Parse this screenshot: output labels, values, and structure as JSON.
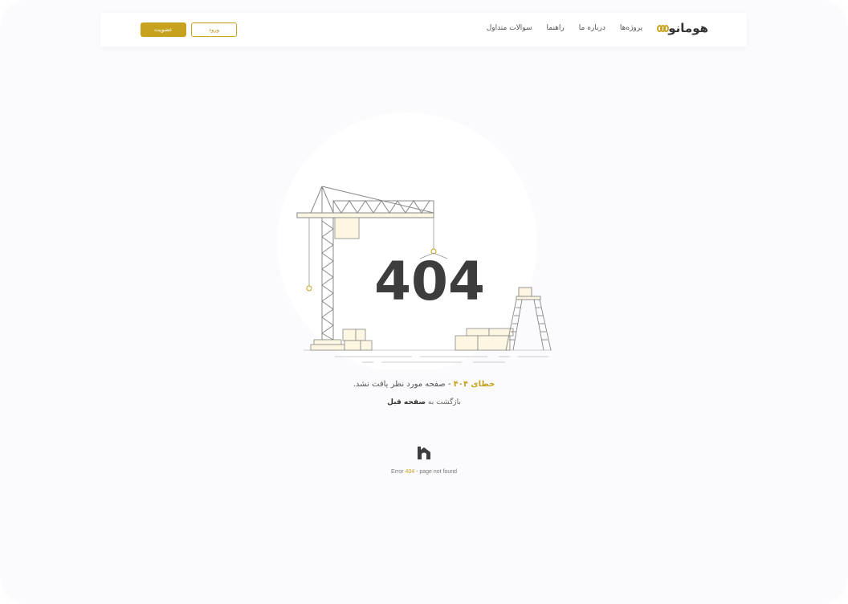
{
  "header": {
    "logo_text": "هومانو",
    "menu": [
      {
        "label": "پروژه‌ها"
      },
      {
        "label": "درباره ما"
      },
      {
        "label": "راهنما"
      },
      {
        "label": "سوالات متداول"
      }
    ],
    "login_label": "ورود",
    "signup_label": "عضویت"
  },
  "illustration": {
    "big_text": "404"
  },
  "message": {
    "error_label": "خطای ۴۰۴",
    "rest": " - صفحه مورد نظر یافت نشد."
  },
  "back": {
    "prefix": "بازگشت به ",
    "link": "صفحه قبل"
  },
  "footer": {
    "prefix": "Error ",
    "code": "404",
    "suffix": " - page not found"
  },
  "colors": {
    "accent": "#c6a21e",
    "dark": "#3d3d3d"
  }
}
